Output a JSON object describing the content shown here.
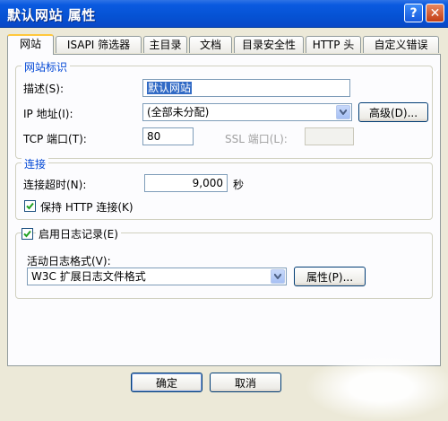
{
  "window": {
    "title": "默认网站 属性",
    "help_label": "?",
    "close_label": "✕"
  },
  "tabs": [
    "网站",
    "ISAPI 筛选器",
    "主目录",
    "文档",
    "目录安全性",
    "HTTP 头",
    "自定义错误"
  ],
  "site_id": {
    "group_title": "网站标识",
    "desc_label": "描述(S):",
    "desc_value": "默认网站",
    "ip_label": "IP 地址(I):",
    "ip_value": "(全部未分配)",
    "advanced_button": "高级(D)...",
    "tcp_label": "TCP 端口(T):",
    "tcp_value": "80",
    "ssl_label": "SSL 端口(L):",
    "ssl_value": ""
  },
  "connection": {
    "group_title": "连接",
    "timeout_label": "连接超时(N):",
    "timeout_value": "9,000",
    "timeout_unit": "秒",
    "keepalive_label": "保持 HTTP 连接(K)",
    "keepalive_checked": true
  },
  "logging": {
    "enable_label": "启用日志记录(E)",
    "enable_checked": true,
    "format_label": "活动日志格式(V):",
    "format_value": "W3C 扩展日志文件格式",
    "properties_button": "属性(P)..."
  },
  "footer": {
    "ok_label": "确定",
    "cancel_label": "取消"
  },
  "colors": {
    "titlebar": "#0552D4",
    "group_title": "#0046D5",
    "tab_highlight": "#FFC83C"
  }
}
